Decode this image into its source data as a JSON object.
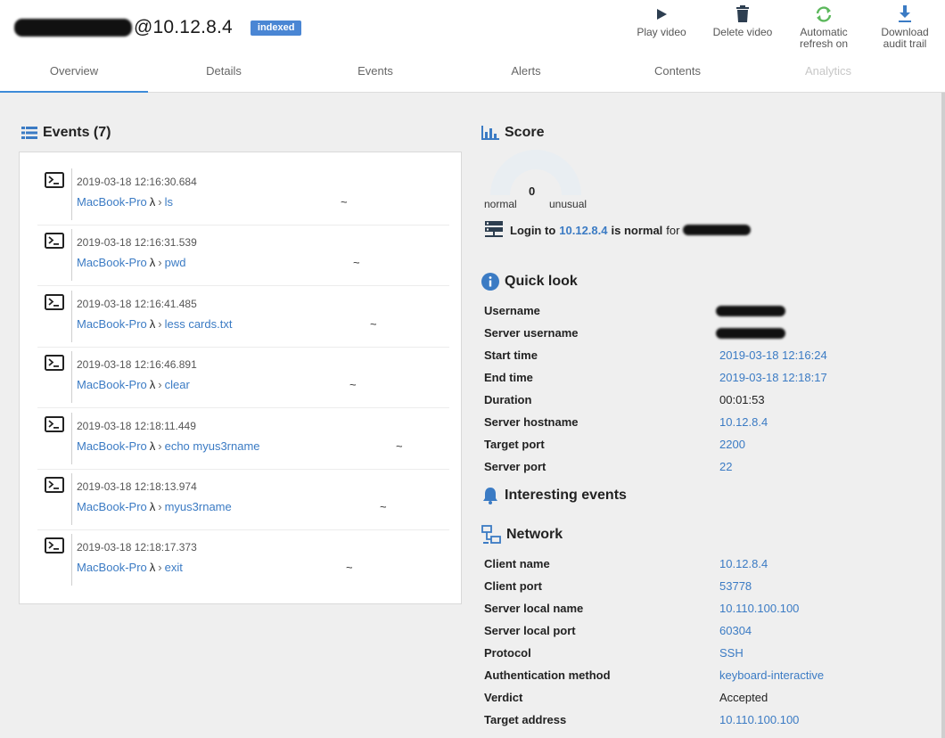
{
  "header": {
    "host": "@10.12.8.4",
    "badge": "indexed",
    "actions": [
      {
        "label": "Play video",
        "icon": "play-icon"
      },
      {
        "label": "Delete video",
        "icon": "trash-icon"
      },
      {
        "label": "Automatic refresh on",
        "icon": "refresh-icon"
      },
      {
        "label": "Download audit trail",
        "icon": "download-icon"
      }
    ]
  },
  "tabs": [
    "Overview",
    "Details",
    "Events",
    "Alerts",
    "Contents",
    "Analytics"
  ],
  "events": {
    "title": "Events (7)",
    "items": [
      {
        "timestamp": "2019-03-18 12:16:30.684",
        "host": "MacBook-Pro",
        "prompt": "λ",
        "sep": "›",
        "command": "ls",
        "cwd": "~"
      },
      {
        "timestamp": "2019-03-18 12:16:31.539",
        "host": "MacBook-Pro",
        "prompt": "λ",
        "sep": "›",
        "command": "pwd",
        "cwd": "~"
      },
      {
        "timestamp": "2019-03-18 12:16:41.485",
        "host": "MacBook-Pro",
        "prompt": "λ",
        "sep": "›",
        "command": "less cards.txt",
        "cwd": "~"
      },
      {
        "timestamp": "2019-03-18 12:16:46.891",
        "host": "MacBook-Pro",
        "prompt": "λ",
        "sep": "›",
        "command": "clear",
        "cwd": "~"
      },
      {
        "timestamp": "2019-03-18 12:18:11.449",
        "host": "MacBook-Pro",
        "prompt": "λ",
        "sep": "›",
        "command": "echo myus3rname",
        "cwd": "~"
      },
      {
        "timestamp": "2019-03-18 12:18:13.974",
        "host": "MacBook-Pro",
        "prompt": "λ",
        "sep": "›",
        "command": "myus3rname",
        "cwd": "~"
      },
      {
        "timestamp": "2019-03-18 12:18:17.373",
        "host": "MacBook-Pro",
        "prompt": "λ",
        "sep": "›",
        "command": "exit",
        "cwd": "~"
      }
    ]
  },
  "score": {
    "title": "Score",
    "value": "0",
    "left_label": "normal",
    "right_label": "unusual",
    "login_prefix": "Login to",
    "login_host": "10.12.8.4",
    "login_mid": "is normal",
    "login_for": "for"
  },
  "quicklook": {
    "title": "Quick look",
    "rows": [
      {
        "label": "Username",
        "value": null
      },
      {
        "label": "Server username",
        "value": null
      },
      {
        "label": "Start time",
        "value": "2019-03-18 12:16:24"
      },
      {
        "label": "End time",
        "value": "2019-03-18 12:18:17"
      },
      {
        "label": "Duration",
        "value": "00:01:53"
      },
      {
        "label": "Server hostname",
        "value": "10.12.8.4"
      },
      {
        "label": "Target port",
        "value": "2200"
      },
      {
        "label": "Server port",
        "value": "22"
      }
    ]
  },
  "interesting": {
    "title": "Interesting events"
  },
  "network": {
    "title": "Network",
    "rows": [
      {
        "label": "Client name",
        "value": "10.12.8.4"
      },
      {
        "label": "Client port",
        "value": "53778"
      },
      {
        "label": "Server local name",
        "value": "10.110.100.100"
      },
      {
        "label": "Server local port",
        "value": "60304"
      },
      {
        "label": "Protocol",
        "value": "SSH"
      },
      {
        "label": "Authentication method",
        "value": "keyboard-interactive"
      },
      {
        "label": "Verdict",
        "value": "Accepted"
      },
      {
        "label": "Target address",
        "value": "10.110.100.100"
      }
    ]
  },
  "colors": {
    "accent": "#3b7bc4",
    "badge": "#4a86d4",
    "refresh": "#5cb85c",
    "tab_underline": "#3d8bd8"
  }
}
